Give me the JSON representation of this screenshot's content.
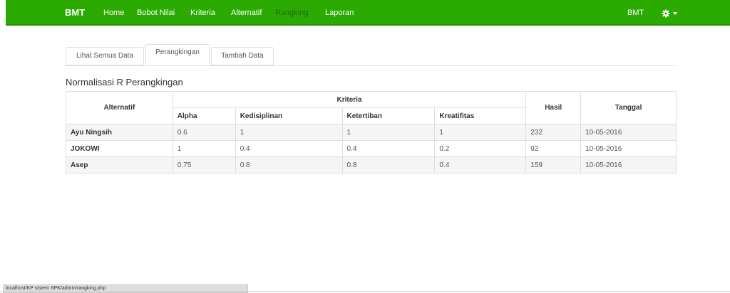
{
  "navbar": {
    "brand": "BMT",
    "items": [
      "Home",
      "Bobot Nilai",
      "Kriteria",
      "Alternatif",
      "Rangking",
      "Laporan"
    ],
    "active_item": "Rangking",
    "user": "BMT",
    "settings_icon": "gear-icon",
    "colors": {
      "bar": "#2bab02",
      "active_text": "#1f6e06"
    }
  },
  "tabs": [
    "Lihat Semua Data",
    "Perangkingan",
    "Tambah Data"
  ],
  "active_tab": "Perangkingan",
  "section_title": "Normalisasi R Perangkingan",
  "table": {
    "header": {
      "alternatif": "Alternatif",
      "kriteria": "Kriteria",
      "hasil": "Hasil",
      "tanggal": "Tanggal",
      "criteria": [
        "Alpha",
        "Kedisiplinan",
        "Ketertiban",
        "Kreatifitas"
      ]
    },
    "rows": [
      {
        "name": "Ayu Ningsih",
        "alpha": "0.6",
        "kedisiplinan": "1",
        "ketertiban": "1",
        "kreatifitas": "1",
        "hasil": "232",
        "tanggal": "10-05-2016"
      },
      {
        "name": "JOKOWI",
        "alpha": "1",
        "kedisiplinan": "0.4",
        "ketertiban": "0.4",
        "kreatifitas": "0.2",
        "hasil": "92",
        "tanggal": "10-05-2016"
      },
      {
        "name": "Asep",
        "alpha": "0.75",
        "kedisiplinan": "0.8",
        "ketertiban": "0.8",
        "kreatifitas": "0.4",
        "hasil": "159",
        "tanggal": "10-05-2016"
      }
    ]
  },
  "status_url": "localhost/KP sistem SPK/admin/rangking.php"
}
